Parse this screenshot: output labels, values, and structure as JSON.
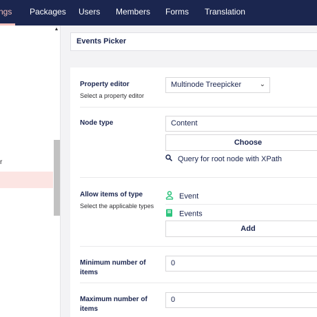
{
  "nav": {
    "items": [
      {
        "label": "ngs",
        "active": true
      },
      {
        "label": "Packages",
        "active": false
      },
      {
        "label": "Users",
        "active": false
      },
      {
        "label": "Members",
        "active": false
      },
      {
        "label": "Forms",
        "active": false
      },
      {
        "label": "Translation",
        "active": false
      }
    ]
  },
  "tree": {
    "partial_item": "r"
  },
  "header": {
    "name_value": "Events Picker"
  },
  "properties": {
    "editor": {
      "label": "Property editor",
      "description": "Select a property editor",
      "selected": "Multinode Treepicker"
    },
    "node_type": {
      "label": "Node type",
      "value": "Content",
      "choose_label": "Choose",
      "query_label": "Query for root node with XPath"
    },
    "allow_items": {
      "label": "Allow items of type",
      "description": "Select the applicable types",
      "items": [
        "Event",
        "Events"
      ],
      "add_label": "Add"
    },
    "min_items": {
      "label_line1": "Minimum number of",
      "label_line2": "items",
      "value": "0"
    },
    "max_items": {
      "label_line1": "Maximum number of",
      "label_line2": "items",
      "value": "0"
    }
  },
  "colors": {
    "nav_bg": "#1b264f",
    "nav_active": "#f5c1bc",
    "selected_tree_bg": "#fce5e3",
    "event_icon": "#2bc37c"
  }
}
